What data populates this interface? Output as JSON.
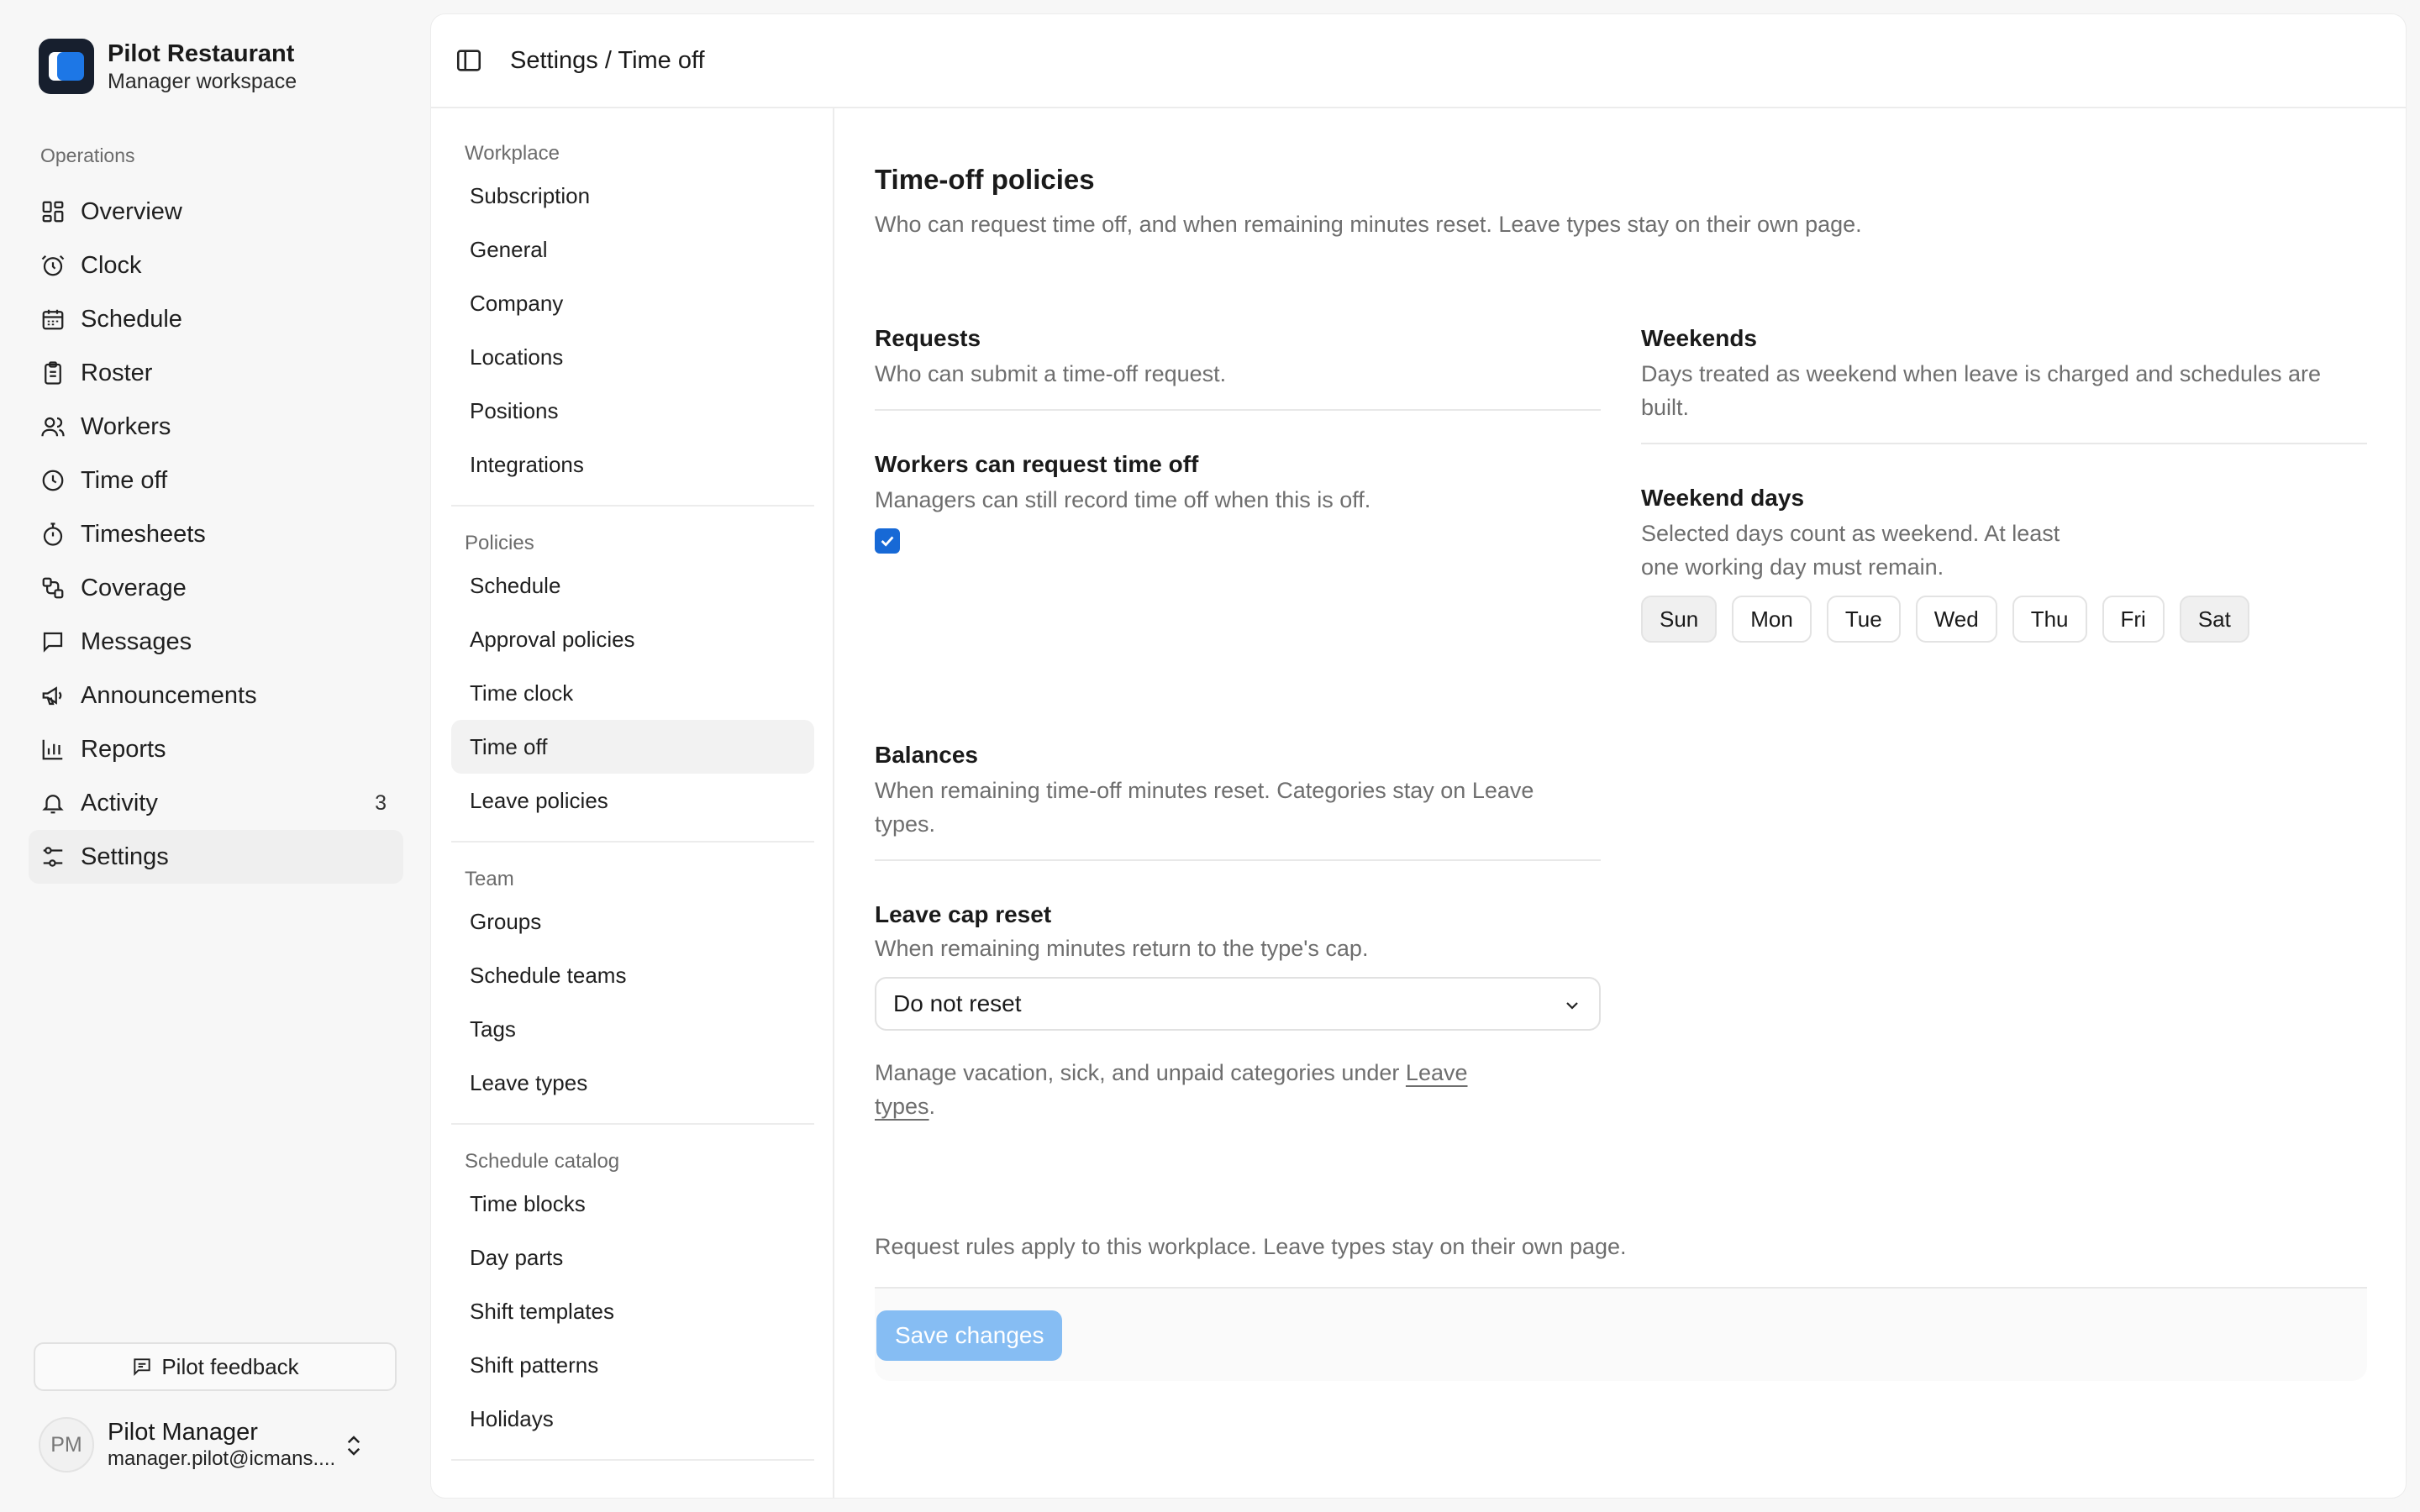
{
  "brand": {
    "name": "Pilot Restaurant",
    "subtitle": "Manager workspace"
  },
  "sidebar": {
    "section_label": "Operations",
    "items": [
      {
        "label": "Overview",
        "icon": "grid-icon"
      },
      {
        "label": "Clock",
        "icon": "alarm-clock-icon"
      },
      {
        "label": "Schedule",
        "icon": "calendar-icon"
      },
      {
        "label": "Roster",
        "icon": "clipboard-icon"
      },
      {
        "label": "Workers",
        "icon": "users-icon"
      },
      {
        "label": "Time off",
        "icon": "clock-icon"
      },
      {
        "label": "Timesheets",
        "icon": "stopwatch-icon"
      },
      {
        "label": "Coverage",
        "icon": "route-icon"
      },
      {
        "label": "Messages",
        "icon": "message-square-icon"
      },
      {
        "label": "Announcements",
        "icon": "megaphone-icon"
      },
      {
        "label": "Reports",
        "icon": "bar-chart-icon"
      },
      {
        "label": "Activity",
        "icon": "bell-icon",
        "badge": "3"
      },
      {
        "label": "Settings",
        "icon": "sliders-icon",
        "active": true
      }
    ],
    "feedback_label": "Pilot feedback",
    "user": {
      "initials": "PM",
      "name": "Pilot Manager",
      "email": "manager.pilot@icmans...."
    }
  },
  "topbar": {
    "breadcrumb": "Settings / Time off"
  },
  "subnav": {
    "groups": [
      {
        "label": "Workplace",
        "items": [
          "Subscription",
          "General",
          "Company",
          "Locations",
          "Positions",
          "Integrations"
        ]
      },
      {
        "label": "Policies",
        "items": [
          "Schedule",
          "Approval policies",
          "Time clock",
          "Time off",
          "Leave policies"
        ]
      },
      {
        "label": "Team",
        "items": [
          "Groups",
          "Schedule teams",
          "Tags",
          "Leave types"
        ]
      },
      {
        "label": "Schedule catalog",
        "items": [
          "Time blocks",
          "Day parts",
          "Shift templates",
          "Shift patterns",
          "Holidays"
        ]
      }
    ],
    "active": "Time off"
  },
  "page": {
    "title": "Time-off policies",
    "description": "Who can request time off, and when remaining minutes reset. Leave types stay on their own page."
  },
  "requests": {
    "title": "Requests",
    "description": "Who can submit a time-off request.",
    "field_title": "Workers can request time off",
    "field_description": "Managers can still record time off when this is off.",
    "checked": true
  },
  "weekends": {
    "title": "Weekends",
    "description": "Days treated as weekend when leave is charged and schedules are built.",
    "field_title": "Weekend days",
    "field_description": "Selected days count as weekend. At least one working day must remain.",
    "days": [
      {
        "label": "Sun",
        "selected": true
      },
      {
        "label": "Mon",
        "selected": false
      },
      {
        "label": "Tue",
        "selected": false
      },
      {
        "label": "Wed",
        "selected": false
      },
      {
        "label": "Thu",
        "selected": false
      },
      {
        "label": "Fri",
        "selected": false
      },
      {
        "label": "Sat",
        "selected": true
      }
    ]
  },
  "balances": {
    "title": "Balances",
    "description": "When remaining time-off minutes reset. Categories stay on Leave types.",
    "field_title": "Leave cap reset",
    "field_description": "When remaining minutes return to the type's cap.",
    "select_value": "Do not reset",
    "note_prefix": "Manage vacation, sick, and unpaid categories under",
    "note_link": "Leave types",
    "note_suffix": "."
  },
  "footer": {
    "note": "Request rules apply to this workplace. Leave types stay on their own page.",
    "save_label": "Save changes"
  },
  "colors": {
    "accent": "#1769d6",
    "brand_logo_bg": "#171f2e",
    "save_disabled": "#86bdf3"
  }
}
